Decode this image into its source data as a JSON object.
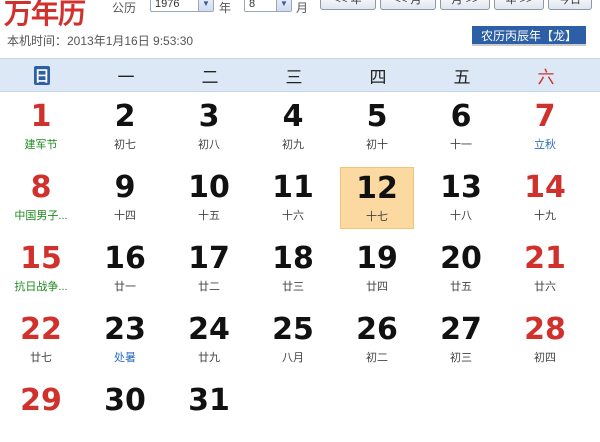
{
  "app": {
    "title": "万年历"
  },
  "top": {
    "calendar_label": "公历",
    "year_value": "1976",
    "year_label": "年",
    "month_value": "8",
    "month_label": "月",
    "nav": [
      {
        "label": "<< 年"
      },
      {
        "label": "<< 月"
      },
      {
        "label": "月 >>"
      },
      {
        "label": "年 >>"
      },
      {
        "label": "今日"
      }
    ],
    "clock": "本机时间：2013年1月16日 9:53:30",
    "lunar_year": "农历丙辰年【龙】"
  },
  "weekdays": [
    "日",
    "一",
    "二",
    "三",
    "四",
    "五",
    "六"
  ],
  "colors": {
    "accent": "#2d5fa6",
    "red": "#d0312d",
    "highlight": "#fbd9a0",
    "header_bg": "#dde8f6"
  },
  "days": [
    {
      "day": "1",
      "sub": "建军节",
      "red": true,
      "sub_color": "green"
    },
    {
      "day": "2",
      "sub": "初七"
    },
    {
      "day": "3",
      "sub": "初八"
    },
    {
      "day": "4",
      "sub": "初九"
    },
    {
      "day": "5",
      "sub": "初十"
    },
    {
      "day": "6",
      "sub": "十一"
    },
    {
      "day": "7",
      "sub": "立秋",
      "red": true,
      "sub_color": "blue"
    },
    {
      "day": "8",
      "sub": "中国男子...",
      "red": true,
      "sub_color": "green"
    },
    {
      "day": "9",
      "sub": "十四"
    },
    {
      "day": "10",
      "sub": "十五"
    },
    {
      "day": "11",
      "sub": "十六"
    },
    {
      "day": "12",
      "sub": "十七",
      "today": true
    },
    {
      "day": "13",
      "sub": "十八"
    },
    {
      "day": "14",
      "sub": "十九",
      "red": true
    },
    {
      "day": "15",
      "sub": "抗日战争...",
      "red": true,
      "sub_color": "green"
    },
    {
      "day": "16",
      "sub": "廿一"
    },
    {
      "day": "17",
      "sub": "廿二"
    },
    {
      "day": "18",
      "sub": "廿三"
    },
    {
      "day": "19",
      "sub": "廿四"
    },
    {
      "day": "20",
      "sub": "廿五"
    },
    {
      "day": "21",
      "sub": "廿六",
      "red": true
    },
    {
      "day": "22",
      "sub": "廿七",
      "red": true
    },
    {
      "day": "23",
      "sub": "处暑",
      "sub_color": "blue"
    },
    {
      "day": "24",
      "sub": "廿九"
    },
    {
      "day": "25",
      "sub": "八月"
    },
    {
      "day": "26",
      "sub": "初二"
    },
    {
      "day": "27",
      "sub": "初三"
    },
    {
      "day": "28",
      "sub": "初四",
      "red": true
    },
    {
      "day": "29",
      "sub": "",
      "red": true
    },
    {
      "day": "30",
      "sub": ""
    },
    {
      "day": "31",
      "sub": ""
    }
  ]
}
